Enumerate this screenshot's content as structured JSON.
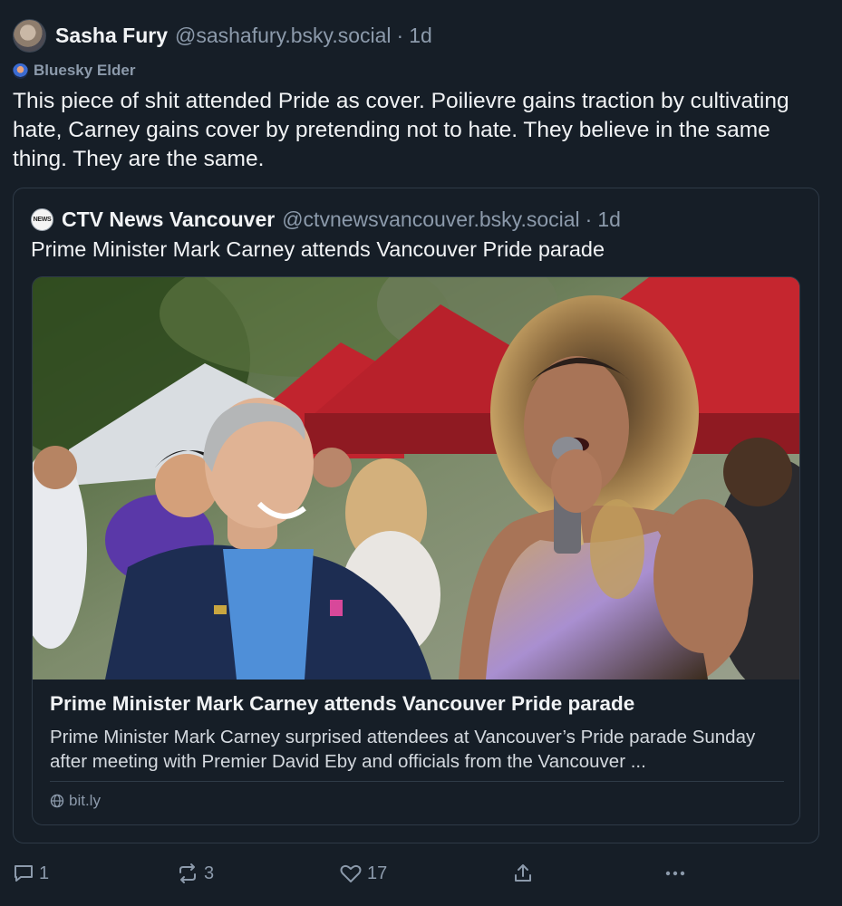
{
  "post": {
    "author": {
      "display_name": "Sasha Fury",
      "handle": "@sashafury.bsky.social",
      "separator": "·",
      "time": "1d",
      "avatar_icon": "fox-avatar"
    },
    "badge": {
      "icon": "bluesky-elder-icon",
      "label": "Bluesky Elder"
    },
    "text": "This piece of shit attended Pride as cover. Poilievre gains traction by cultivating hate, Carney gains cover by pretending not to hate. They believe in the same thing. They are the same."
  },
  "quote": {
    "author": {
      "display_name": "CTV News Vancouver",
      "handle": "@ctvnewsvancouver.bsky.social",
      "separator": "·",
      "time": "1d",
      "avatar_text": "NEWS"
    },
    "text": "Prime Minister Mark Carney attends Vancouver Pride parade",
    "link_card": {
      "image_icon": "pride-parade-photo",
      "title": "Prime Minister Mark Carney attends Vancouver Pride parade",
      "description": "Prime Minister Mark Carney surprised attendees at Vancouver’s Pride parade Sunday after meeting with Premier David Eby and officials from the Vancouver ...",
      "domain": "bit.ly",
      "domain_icon": "globe-icon"
    }
  },
  "actions": {
    "reply": {
      "icon": "reply-icon",
      "count": "1"
    },
    "repost": {
      "icon": "repost-icon",
      "count": "3"
    },
    "like": {
      "icon": "heart-icon",
      "count": "17"
    },
    "share": {
      "icon": "share-icon"
    },
    "more": {
      "icon": "more-icon"
    }
  },
  "colors": {
    "background": "#161e27",
    "border": "#2e3a47",
    "text_primary": "#f1f3f5",
    "text_secondary": "#8c9aab"
  }
}
